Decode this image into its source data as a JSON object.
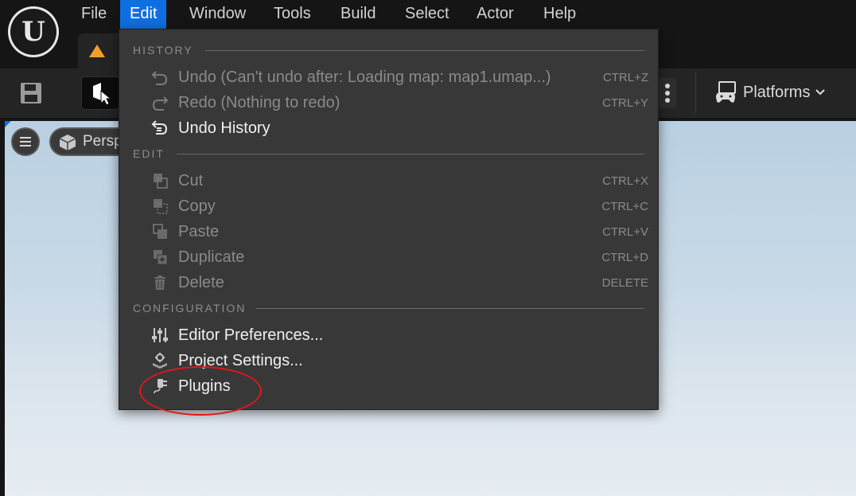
{
  "menubar": {
    "items": [
      {
        "label": "File"
      },
      {
        "label": "Edit"
      },
      {
        "label": "Window"
      },
      {
        "label": "Tools"
      },
      {
        "label": "Build"
      },
      {
        "label": "Select"
      },
      {
        "label": "Actor"
      },
      {
        "label": "Help"
      }
    ],
    "active_item": "Edit"
  },
  "toolbar": {
    "platforms_label": "Platforms"
  },
  "viewport": {
    "perspective_label": "Perspective"
  },
  "edit_menu": {
    "sections": [
      {
        "header": "HISTORY",
        "items": [
          {
            "label": "Undo (Can't undo after: Loading map: map1.umap...)",
            "shortcut": "CTRL+Z",
            "enabled": false,
            "icon": "undo-icon"
          },
          {
            "label": "Redo (Nothing to redo)",
            "shortcut": "CTRL+Y",
            "enabled": false,
            "icon": "redo-icon"
          },
          {
            "label": "Undo History",
            "shortcut": "",
            "enabled": true,
            "icon": "undo-history-icon"
          }
        ]
      },
      {
        "header": "EDIT",
        "items": [
          {
            "label": "Cut",
            "shortcut": "CTRL+X",
            "enabled": false,
            "icon": "cut-icon"
          },
          {
            "label": "Copy",
            "shortcut": "CTRL+C",
            "enabled": false,
            "icon": "copy-icon"
          },
          {
            "label": "Paste",
            "shortcut": "CTRL+V",
            "enabled": false,
            "icon": "paste-icon"
          },
          {
            "label": "Duplicate",
            "shortcut": "CTRL+D",
            "enabled": false,
            "icon": "duplicate-icon"
          },
          {
            "label": "Delete",
            "shortcut": "DELETE",
            "enabled": false,
            "icon": "trash-icon"
          }
        ]
      },
      {
        "header": "CONFIGURATION",
        "items": [
          {
            "label": "Editor Preferences...",
            "shortcut": "",
            "enabled": true,
            "icon": "sliders-icon"
          },
          {
            "label": "Project Settings...",
            "shortcut": "",
            "enabled": true,
            "icon": "gear-box-icon"
          },
          {
            "label": "Plugins",
            "shortcut": "",
            "enabled": true,
            "icon": "plug-icon"
          }
        ]
      }
    ]
  },
  "colors": {
    "accent": "#0e6fe0",
    "menu_bg": "#383838",
    "highlight": "#e01818",
    "warning": "#f0a028"
  }
}
